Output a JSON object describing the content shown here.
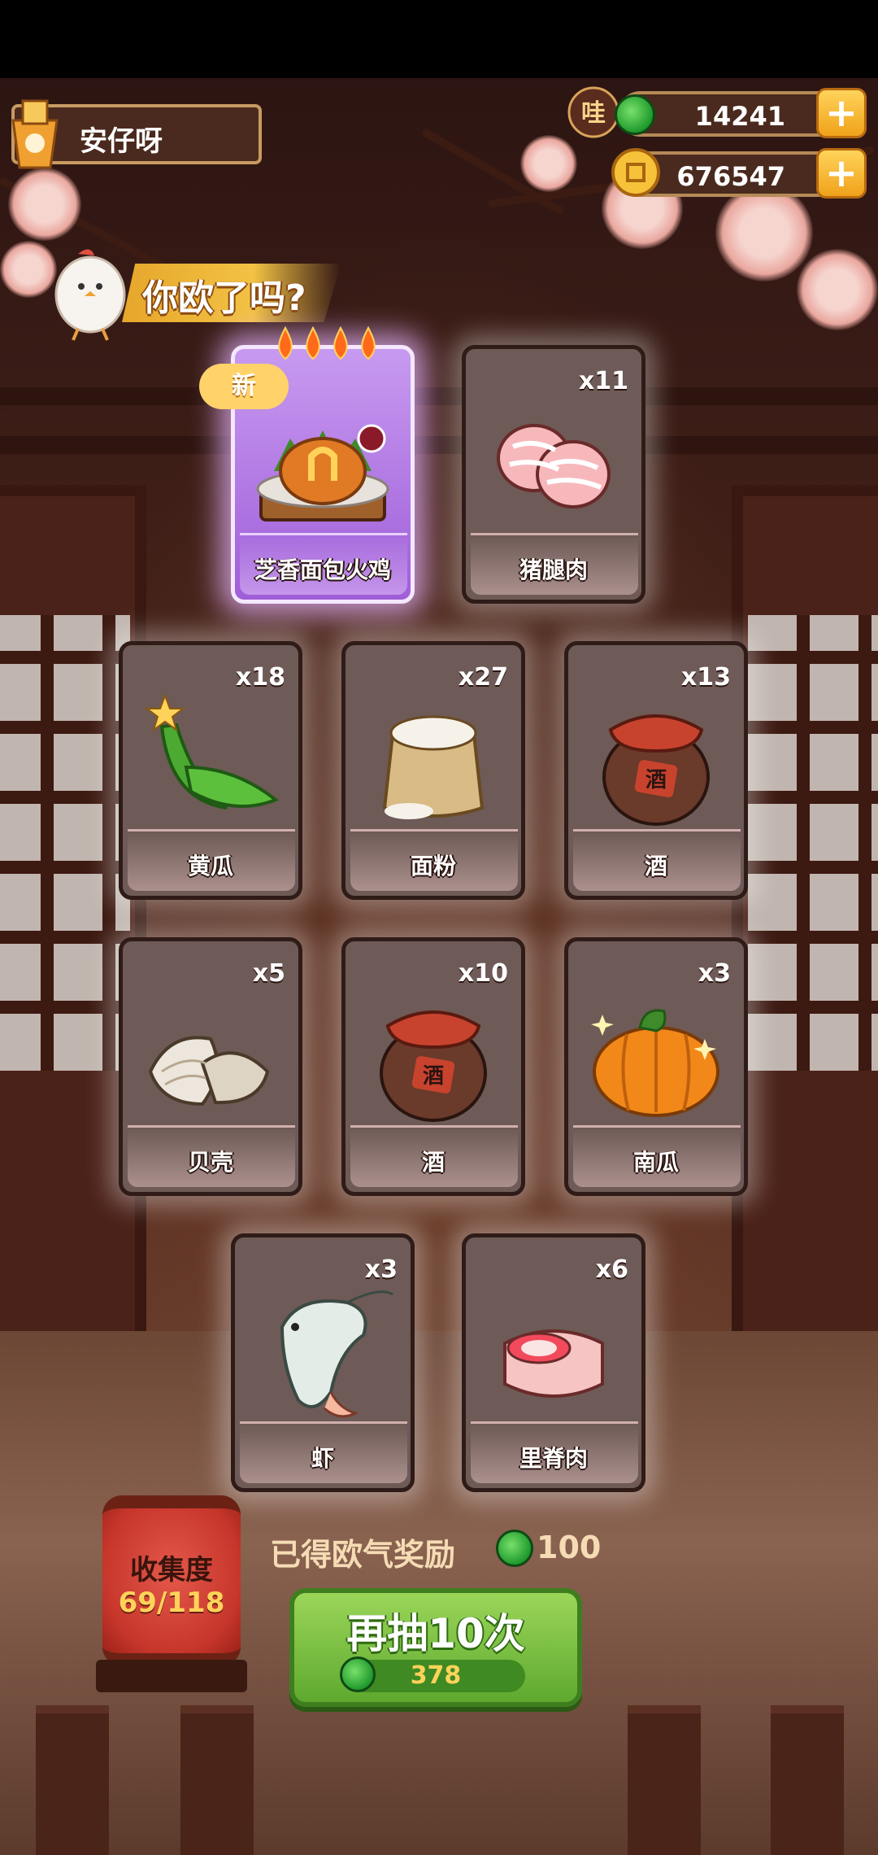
{
  "player": {
    "name": "安仔呀"
  },
  "resources": [
    {
      "name": "jade",
      "value": "14241",
      "icon": "jade-coin-icon"
    },
    {
      "name": "gold",
      "value": "676547",
      "icon": "gold-coin-icon"
    }
  ],
  "banner": {
    "title": "你欧了吗?"
  },
  "cards": [
    {
      "name": "芝香面包火鸡",
      "count": "",
      "badge": "新",
      "rarity_flames": 4,
      "special": true,
      "icon": "roast-turkey-icon"
    },
    {
      "name": "猪腿肉",
      "count": "x11",
      "icon": "pork-leg-icon"
    },
    {
      "name": "黄瓜",
      "count": "x18",
      "icon": "cucumber-icon"
    },
    {
      "name": "面粉",
      "count": "x27",
      "icon": "flour-sack-icon"
    },
    {
      "name": "酒",
      "count": "x13",
      "icon": "wine-jar-icon",
      "jar_label": "酒"
    },
    {
      "name": "贝壳",
      "count": "x5",
      "icon": "shell-icon"
    },
    {
      "name": "酒",
      "count": "x10",
      "icon": "wine-jar-icon",
      "jar_label": "酒"
    },
    {
      "name": "南瓜",
      "count": "x3",
      "icon": "pumpkin-icon"
    },
    {
      "name": "虾",
      "count": "x3",
      "icon": "shrimp-icon"
    },
    {
      "name": "里脊肉",
      "count": "x6",
      "icon": "tenderloin-icon"
    }
  ],
  "collection": {
    "title": "收集度",
    "progress": "69/118"
  },
  "reward": {
    "label": "已得欧气奖励",
    "value": "100"
  },
  "draw": {
    "label": "再抽10次",
    "cost": "378"
  },
  "colors": {
    "card_bg": "#6e5a56",
    "special_card": "#b277e4",
    "button_green": "#7cc244",
    "gold": "#f2b22a"
  }
}
